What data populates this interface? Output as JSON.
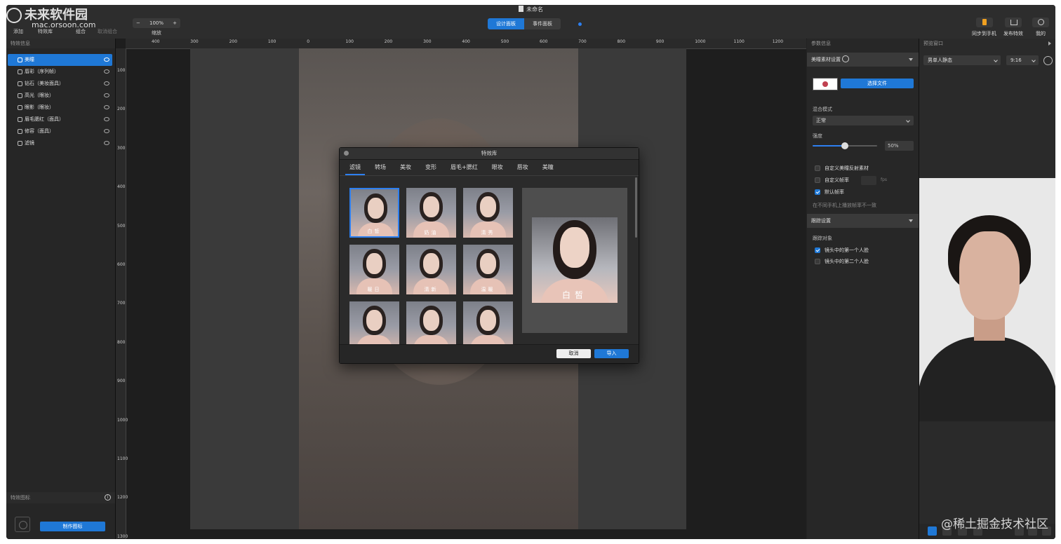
{
  "watermark": {
    "brand": "未来软件园",
    "url": "mac.orsoon.com"
  },
  "toolbar": {
    "doc_title": "未命名",
    "add": "添加",
    "effects_lib": "特效库",
    "group": "组合",
    "ungroup": "取消组合",
    "zoom_value": "100%",
    "zoom_minus": "−",
    "zoom_plus": "+",
    "zoom_label": "缩放",
    "design_panel": "设计面板",
    "event_panel": "事件面板",
    "sync_phone": "同步到手机",
    "publish": "发布特效",
    "mine": "我的"
  },
  "left_panel": {
    "title": "特效信息",
    "layers": [
      {
        "label": "美瞳"
      },
      {
        "label": "唇彩（序列帧）"
      },
      {
        "label": "钻石（美妆面具）"
      },
      {
        "label": "高光（眼妆）"
      },
      {
        "label": "眼影（眼妆）"
      },
      {
        "label": "眉毛腮红（面具）"
      },
      {
        "label": "修容（面具）"
      },
      {
        "label": "滤镜"
      }
    ],
    "icon_title": "特效图标",
    "make_icon": "制作图标"
  },
  "rulers": {
    "top": [
      "400",
      "300",
      "200",
      "100",
      "0",
      "100",
      "200",
      "300",
      "400",
      "500",
      "600",
      "700",
      "800",
      "900",
      "1000",
      "1100",
      "1200"
    ],
    "left": [
      "100",
      "200",
      "300",
      "400",
      "500",
      "600",
      "700",
      "800",
      "900",
      "1000",
      "1100",
      "1200",
      "1300"
    ]
  },
  "dialog": {
    "title": "特效库",
    "tabs": [
      "滤镜",
      "转场",
      "美妆",
      "变形",
      "眉毛+腮红",
      "眼妆",
      "唇妆",
      "美瞳"
    ],
    "thumbs": [
      "白皙",
      "奶油",
      "清秀",
      "暖日",
      "清新",
      "温暖",
      "",
      "",
      ""
    ],
    "preview_caption": "白皙",
    "cancel": "取消",
    "import": "导入"
  },
  "properties": {
    "title": "参数信息",
    "section1": "美瞳素材设置",
    "choose_file": "选择文件",
    "blend_label": "混合模式",
    "blend_value": "正常",
    "strength_label": "强度",
    "strength_value": "50%",
    "strength": 0.5,
    "custom_reflect": "自定义美瞳反射素材",
    "custom_fps": "自定义帧率",
    "fps_unit": "fps",
    "default_fps": "默认帧率",
    "fps_note": "在不同手机上播放帧率不一致",
    "section2": "跟踪设置",
    "track_label": "跟踪对象",
    "track_first": "镜头中的第一个人脸",
    "track_second": "镜头中的第二个人脸"
  },
  "preview": {
    "title": "预览窗口",
    "model": "男单人静态",
    "ratio": "9:16"
  },
  "credit": "@稀土掘金技术社区"
}
